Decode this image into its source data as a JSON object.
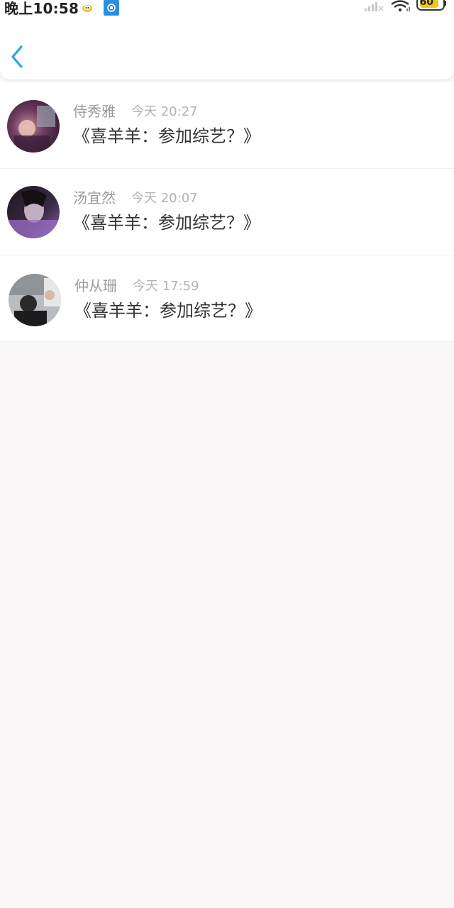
{
  "status_bar": {
    "time": "晚上10:58",
    "battery": "60"
  },
  "header": {
    "back_icon": "chevron-left-icon",
    "accent_color": "#2aa4e6"
  },
  "comments": [
    {
      "name": "侍秀雅",
      "time": "今天 20:27",
      "text": "《喜羊羊：参加综艺？》",
      "avatar_icon": "avatar-image"
    },
    {
      "name": "汤宜然",
      "time": "今天 20:07",
      "text": "《喜羊羊：参加综艺？》",
      "avatar_icon": "avatar-image"
    },
    {
      "name": "仲从珊",
      "time": "今天 17:59",
      "text": "《喜羊羊：参加综艺？》",
      "avatar_icon": "avatar-image"
    }
  ]
}
